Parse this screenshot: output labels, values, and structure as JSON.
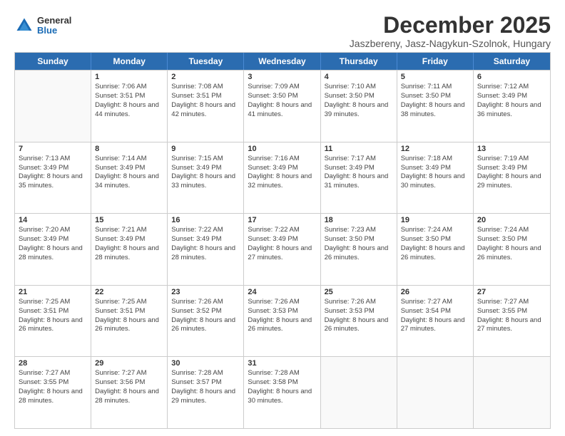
{
  "logo": {
    "general": "General",
    "blue": "Blue"
  },
  "title": "December 2025",
  "subtitle": "Jaszbereny, Jasz-Nagykun-Szolnok, Hungary",
  "header_days": [
    "Sunday",
    "Monday",
    "Tuesday",
    "Wednesday",
    "Thursday",
    "Friday",
    "Saturday"
  ],
  "weeks": [
    [
      {
        "day": "",
        "empty": true
      },
      {
        "day": "1",
        "sunrise": "Sunrise: 7:06 AM",
        "sunset": "Sunset: 3:51 PM",
        "daylight": "Daylight: 8 hours and 44 minutes."
      },
      {
        "day": "2",
        "sunrise": "Sunrise: 7:08 AM",
        "sunset": "Sunset: 3:51 PM",
        "daylight": "Daylight: 8 hours and 42 minutes."
      },
      {
        "day": "3",
        "sunrise": "Sunrise: 7:09 AM",
        "sunset": "Sunset: 3:50 PM",
        "daylight": "Daylight: 8 hours and 41 minutes."
      },
      {
        "day": "4",
        "sunrise": "Sunrise: 7:10 AM",
        "sunset": "Sunset: 3:50 PM",
        "daylight": "Daylight: 8 hours and 39 minutes."
      },
      {
        "day": "5",
        "sunrise": "Sunrise: 7:11 AM",
        "sunset": "Sunset: 3:50 PM",
        "daylight": "Daylight: 8 hours and 38 minutes."
      },
      {
        "day": "6",
        "sunrise": "Sunrise: 7:12 AM",
        "sunset": "Sunset: 3:49 PM",
        "daylight": "Daylight: 8 hours and 36 minutes."
      }
    ],
    [
      {
        "day": "7",
        "sunrise": "Sunrise: 7:13 AM",
        "sunset": "Sunset: 3:49 PM",
        "daylight": "Daylight: 8 hours and 35 minutes."
      },
      {
        "day": "8",
        "sunrise": "Sunrise: 7:14 AM",
        "sunset": "Sunset: 3:49 PM",
        "daylight": "Daylight: 8 hours and 34 minutes."
      },
      {
        "day": "9",
        "sunrise": "Sunrise: 7:15 AM",
        "sunset": "Sunset: 3:49 PM",
        "daylight": "Daylight: 8 hours and 33 minutes."
      },
      {
        "day": "10",
        "sunrise": "Sunrise: 7:16 AM",
        "sunset": "Sunset: 3:49 PM",
        "daylight": "Daylight: 8 hours and 32 minutes."
      },
      {
        "day": "11",
        "sunrise": "Sunrise: 7:17 AM",
        "sunset": "Sunset: 3:49 PM",
        "daylight": "Daylight: 8 hours and 31 minutes."
      },
      {
        "day": "12",
        "sunrise": "Sunrise: 7:18 AM",
        "sunset": "Sunset: 3:49 PM",
        "daylight": "Daylight: 8 hours and 30 minutes."
      },
      {
        "day": "13",
        "sunrise": "Sunrise: 7:19 AM",
        "sunset": "Sunset: 3:49 PM",
        "daylight": "Daylight: 8 hours and 29 minutes."
      }
    ],
    [
      {
        "day": "14",
        "sunrise": "Sunrise: 7:20 AM",
        "sunset": "Sunset: 3:49 PM",
        "daylight": "Daylight: 8 hours and 28 minutes."
      },
      {
        "day": "15",
        "sunrise": "Sunrise: 7:21 AM",
        "sunset": "Sunset: 3:49 PM",
        "daylight": "Daylight: 8 hours and 28 minutes."
      },
      {
        "day": "16",
        "sunrise": "Sunrise: 7:22 AM",
        "sunset": "Sunset: 3:49 PM",
        "daylight": "Daylight: 8 hours and 28 minutes."
      },
      {
        "day": "17",
        "sunrise": "Sunrise: 7:22 AM",
        "sunset": "Sunset: 3:49 PM",
        "daylight": "Daylight: 8 hours and 27 minutes."
      },
      {
        "day": "18",
        "sunrise": "Sunrise: 7:23 AM",
        "sunset": "Sunset: 3:50 PM",
        "daylight": "Daylight: 8 hours and 26 minutes."
      },
      {
        "day": "19",
        "sunrise": "Sunrise: 7:24 AM",
        "sunset": "Sunset: 3:50 PM",
        "daylight": "Daylight: 8 hours and 26 minutes."
      },
      {
        "day": "20",
        "sunrise": "Sunrise: 7:24 AM",
        "sunset": "Sunset: 3:50 PM",
        "daylight": "Daylight: 8 hours and 26 minutes."
      }
    ],
    [
      {
        "day": "21",
        "sunrise": "Sunrise: 7:25 AM",
        "sunset": "Sunset: 3:51 PM",
        "daylight": "Daylight: 8 hours and 26 minutes."
      },
      {
        "day": "22",
        "sunrise": "Sunrise: 7:25 AM",
        "sunset": "Sunset: 3:51 PM",
        "daylight": "Daylight: 8 hours and 26 minutes."
      },
      {
        "day": "23",
        "sunrise": "Sunrise: 7:26 AM",
        "sunset": "Sunset: 3:52 PM",
        "daylight": "Daylight: 8 hours and 26 minutes."
      },
      {
        "day": "24",
        "sunrise": "Sunrise: 7:26 AM",
        "sunset": "Sunset: 3:53 PM",
        "daylight": "Daylight: 8 hours and 26 minutes."
      },
      {
        "day": "25",
        "sunrise": "Sunrise: 7:26 AM",
        "sunset": "Sunset: 3:53 PM",
        "daylight": "Daylight: 8 hours and 26 minutes."
      },
      {
        "day": "26",
        "sunrise": "Sunrise: 7:27 AM",
        "sunset": "Sunset: 3:54 PM",
        "daylight": "Daylight: 8 hours and 27 minutes."
      },
      {
        "day": "27",
        "sunrise": "Sunrise: 7:27 AM",
        "sunset": "Sunset: 3:55 PM",
        "daylight": "Daylight: 8 hours and 27 minutes."
      }
    ],
    [
      {
        "day": "28",
        "sunrise": "Sunrise: 7:27 AM",
        "sunset": "Sunset: 3:55 PM",
        "daylight": "Daylight: 8 hours and 28 minutes."
      },
      {
        "day": "29",
        "sunrise": "Sunrise: 7:27 AM",
        "sunset": "Sunset: 3:56 PM",
        "daylight": "Daylight: 8 hours and 28 minutes."
      },
      {
        "day": "30",
        "sunrise": "Sunrise: 7:28 AM",
        "sunset": "Sunset: 3:57 PM",
        "daylight": "Daylight: 8 hours and 29 minutes."
      },
      {
        "day": "31",
        "sunrise": "Sunrise: 7:28 AM",
        "sunset": "Sunset: 3:58 PM",
        "daylight": "Daylight: 8 hours and 30 minutes."
      },
      {
        "day": "",
        "empty": true
      },
      {
        "day": "",
        "empty": true
      },
      {
        "day": "",
        "empty": true
      }
    ]
  ]
}
